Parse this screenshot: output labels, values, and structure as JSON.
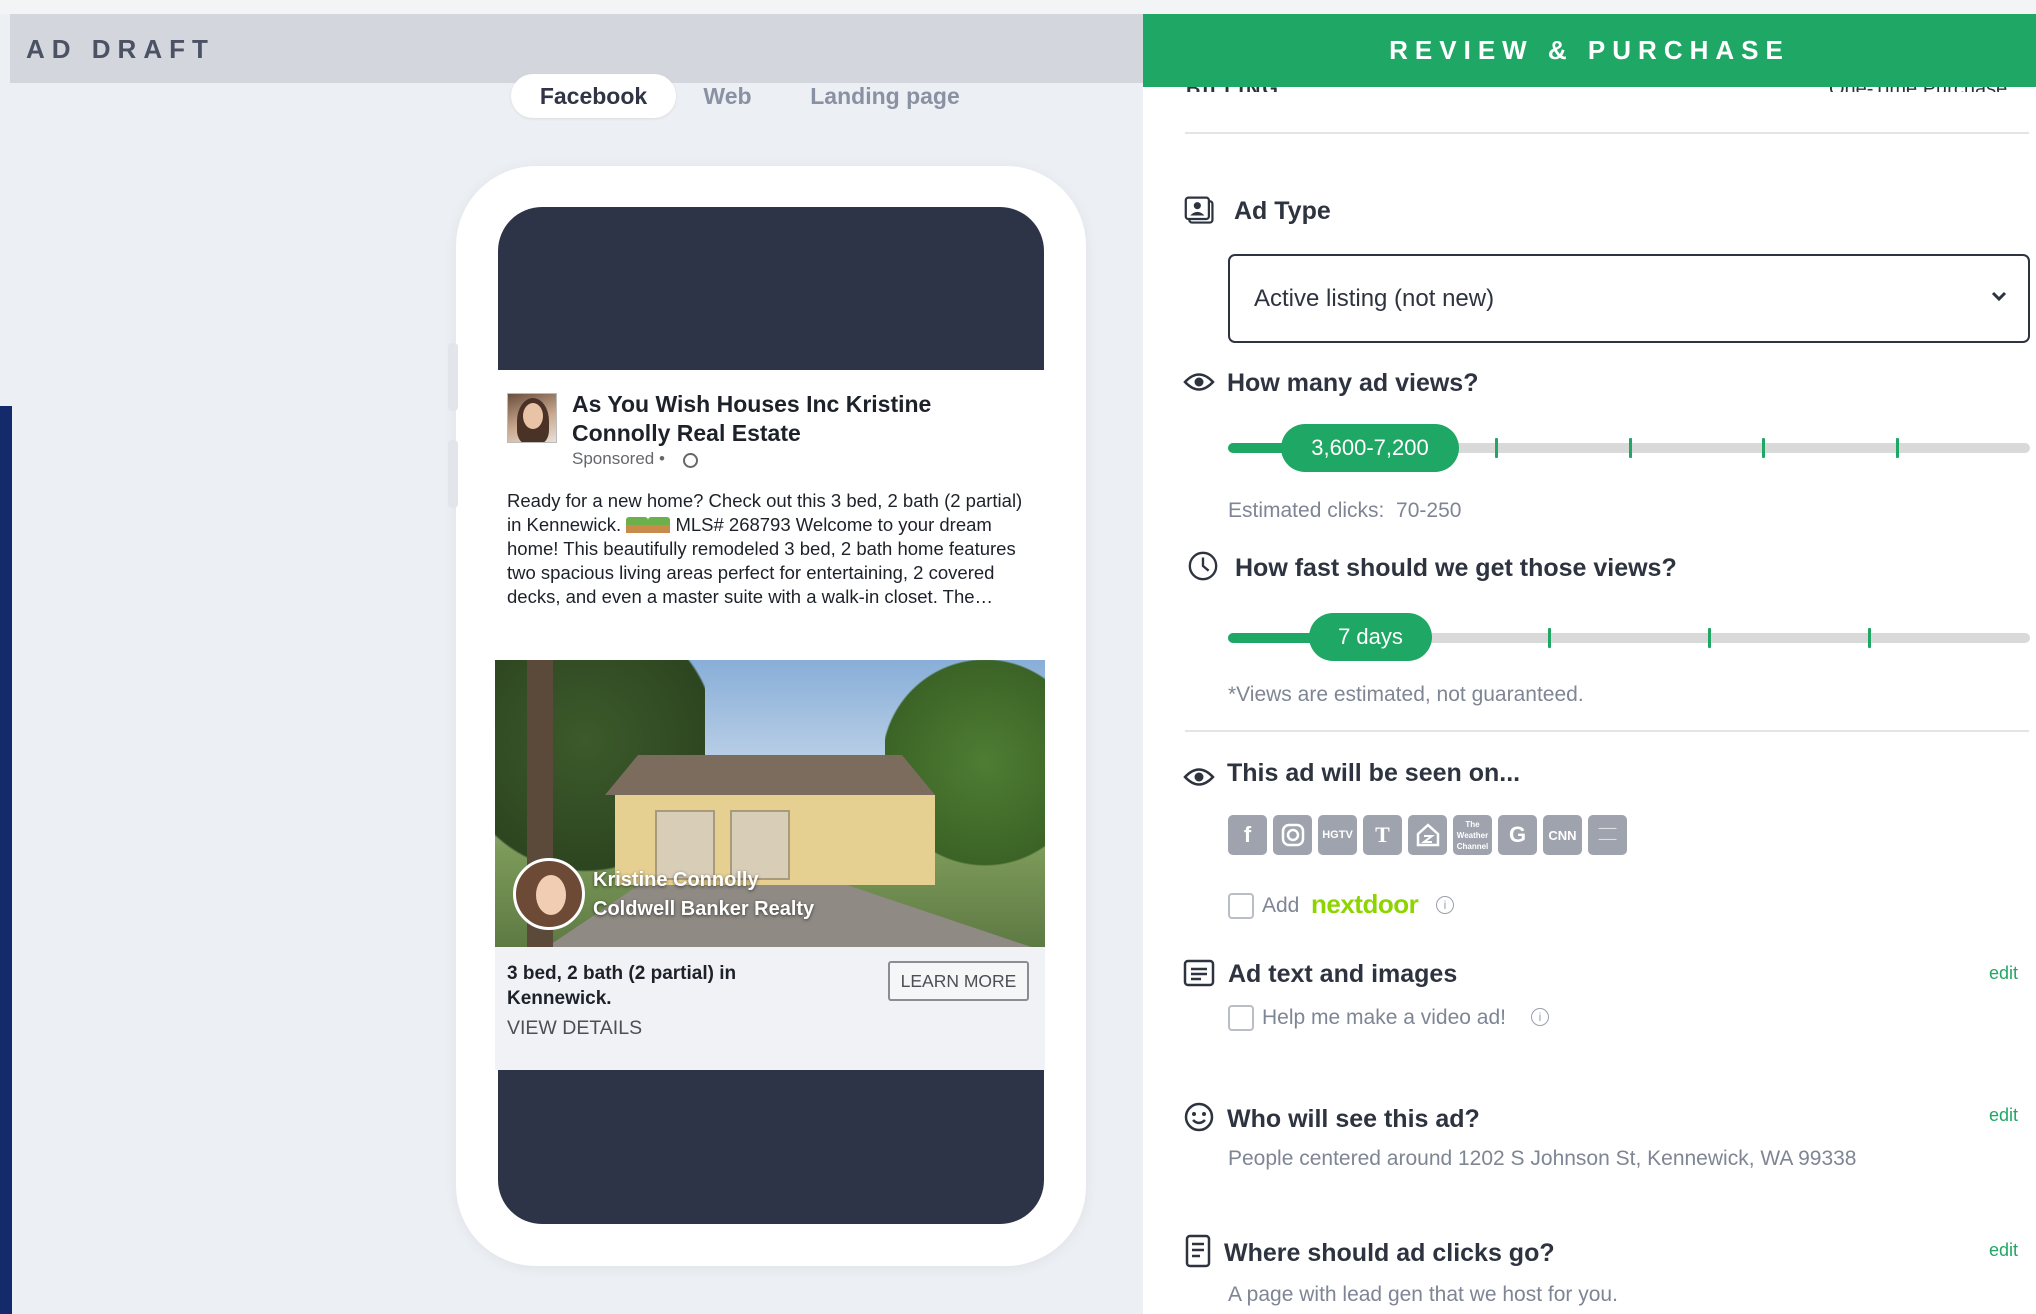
{
  "header": {
    "draft_title": "AD DRAFT",
    "review_title": "REVIEW & PURCHASE"
  },
  "tabs": [
    {
      "label": "Facebook",
      "active": true
    },
    {
      "label": "Web",
      "active": false
    },
    {
      "label": "Landing page",
      "active": false
    }
  ],
  "preview": {
    "page_name": "As You Wish Houses Inc Kristine Connolly Real Estate",
    "sponsored": "Sponsored •",
    "body_part1": "Ready for a new home? Check out this 3 bed, 2 bath (2 partial) in Kennewick.",
    "body_part2": "MLS# 268793 Welcome to your dream home! This beautifully remodeled 3 bed, 2 bath home features two spacious living areas perfect for entertaining, 2 covered decks, and even a master suite with a walk-in closet. The…",
    "agent_name": "Kristine Connolly",
    "agent_company": "Coldwell Banker Realty",
    "link_title": "3 bed, 2 bath (2 partial) in Kennewick.",
    "link_details": "VIEW DETAILS",
    "cta": "LEARN MORE"
  },
  "review": {
    "billing_label": "BILLING",
    "billing_value": "One-Time Purchase",
    "ad_type": {
      "title": "Ad Type",
      "selected": "Active listing (not new)"
    },
    "views": {
      "title": "How many ad views?",
      "selected": "3,600-7,200",
      "estimated_label": "Estimated clicks:",
      "estimated_value": "70-250"
    },
    "speed": {
      "title": "How fast should we get those views?",
      "selected": "7 days",
      "note": "*Views are estimated, not guaranteed."
    },
    "seen_on": {
      "title": "This ad will be seen on...",
      "platforms": [
        "facebook-icon",
        "instagram-icon",
        "hgtv-icon",
        "nytimes-icon",
        "zillow-icon",
        "weather-channel-icon",
        "google-icon",
        "cnn-icon",
        "news-network-icon"
      ],
      "add_label": "Add",
      "nextdoor": "nextdoor"
    },
    "ad_text": {
      "title": "Ad text and images",
      "edit": "edit",
      "video_label": "Help me make a video ad!"
    },
    "audience": {
      "title": "Who will see this ad?",
      "edit": "edit",
      "description": "People centered around 1202 S Johnson St, Kennewick, WA 99338"
    },
    "clicks": {
      "title": "Where should ad clicks go?",
      "edit": "edit",
      "description": "A page with lead gen that we host for you."
    }
  },
  "colors": {
    "accent_green": "#1fa765",
    "phone_dark": "#2d3447",
    "header_grey": "#d4d6de",
    "nextdoor_green": "#8ed500"
  }
}
